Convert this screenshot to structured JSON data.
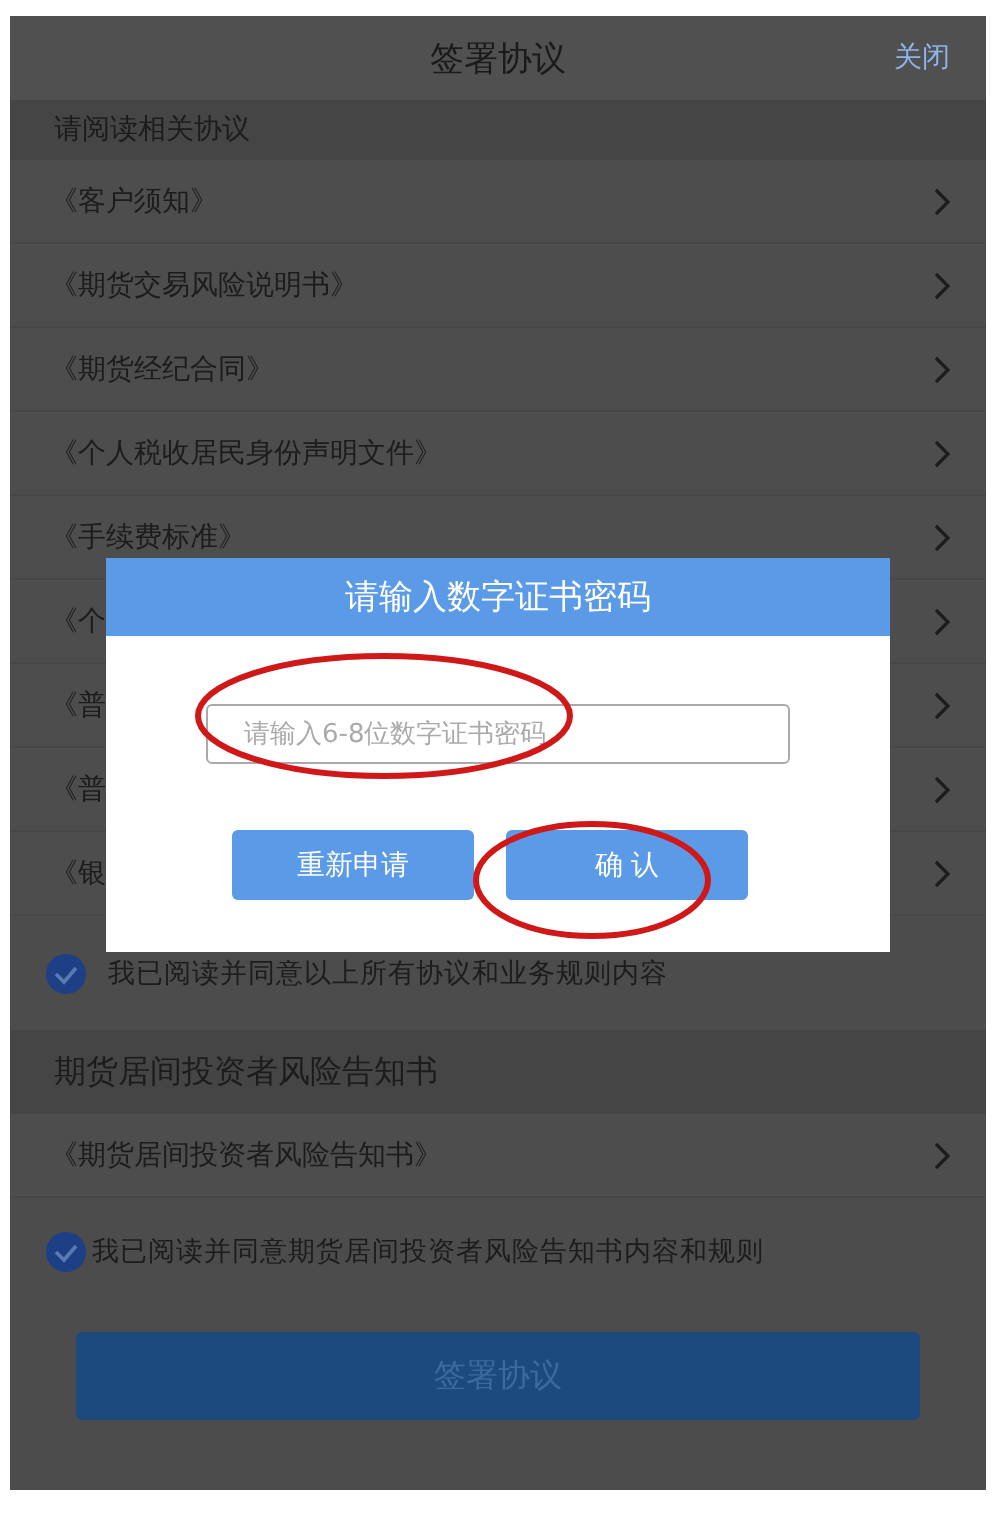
{
  "header": {
    "title": "签署协议",
    "close": "关闭"
  },
  "sections": [
    {
      "title": "请阅读相关协议",
      "items": [
        "《客户须知》",
        "《期货交易风险说明书》",
        "《期货经纪合同》",
        "《个人税收居民身份声明文件》",
        "《手续费标准》",
        "《个",
        "《普",
        "《普",
        "《银"
      ],
      "agreement": {
        "text": "我已阅读并同意以上所有协议和业务规则内容",
        "checked": true
      }
    },
    {
      "title": "期货居间投资者风险告知书",
      "items": [
        "《期货居间投资者风险告知书》"
      ],
      "agreement": {
        "text": "我已阅读并同意期货居间投资者风险告知书内容和规则",
        "checked": true
      }
    }
  ],
  "submit": "签署协议",
  "dialog": {
    "title": "请输入数字证书密码",
    "placeholder": "请输入6-8位数字证书密码",
    "buttons": [
      "重新申请",
      "确 认"
    ]
  }
}
